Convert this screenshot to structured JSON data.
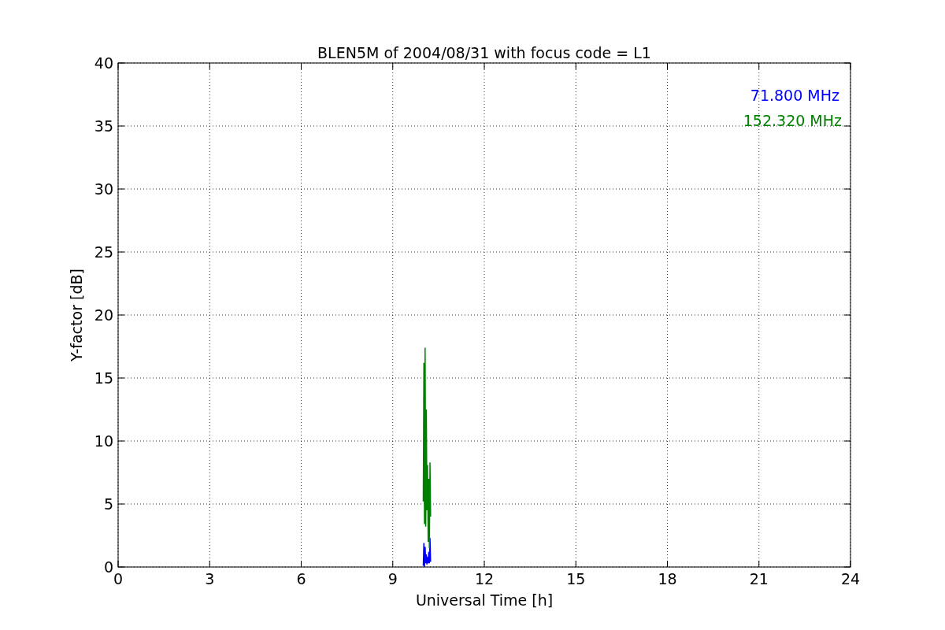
{
  "figure": {
    "chart_data": {
      "type": "line",
      "title": "BLEN5M of 2004/08/31 with focus code = L1",
      "xlabel": "Universal Time [h]",
      "ylabel": "Y-factor [dB]",
      "x": [
        10.0,
        10.02,
        10.04,
        10.06,
        10.08,
        10.1,
        10.12,
        10.14,
        10.16,
        10.18,
        10.2,
        10.22,
        10.24
      ],
      "series": [
        {
          "name": "71.800 MHz",
          "color": "#0000ff",
          "values": [
            0.1,
            1.9,
            0.0,
            1.6,
            0.3,
            1.0,
            0.2,
            0.8,
            0.3,
            1.2,
            0.3,
            2.3,
            0.4
          ]
        },
        {
          "name": "152.320 MHz",
          "color": "#008000",
          "values": [
            5.2,
            16.2,
            3.4,
            17.4,
            3.2,
            12.5,
            4.5,
            8.1,
            2.0,
            7.0,
            1.5,
            8.3,
            4.0
          ]
        }
      ],
      "xlim": [
        0,
        24
      ],
      "ylim": [
        0,
        40
      ],
      "xticks": [
        0,
        3,
        6,
        9,
        12,
        15,
        18,
        21,
        24
      ],
      "yticks": [
        0,
        5,
        10,
        15,
        20,
        25,
        30,
        35,
        40
      ],
      "grid": true
    }
  }
}
